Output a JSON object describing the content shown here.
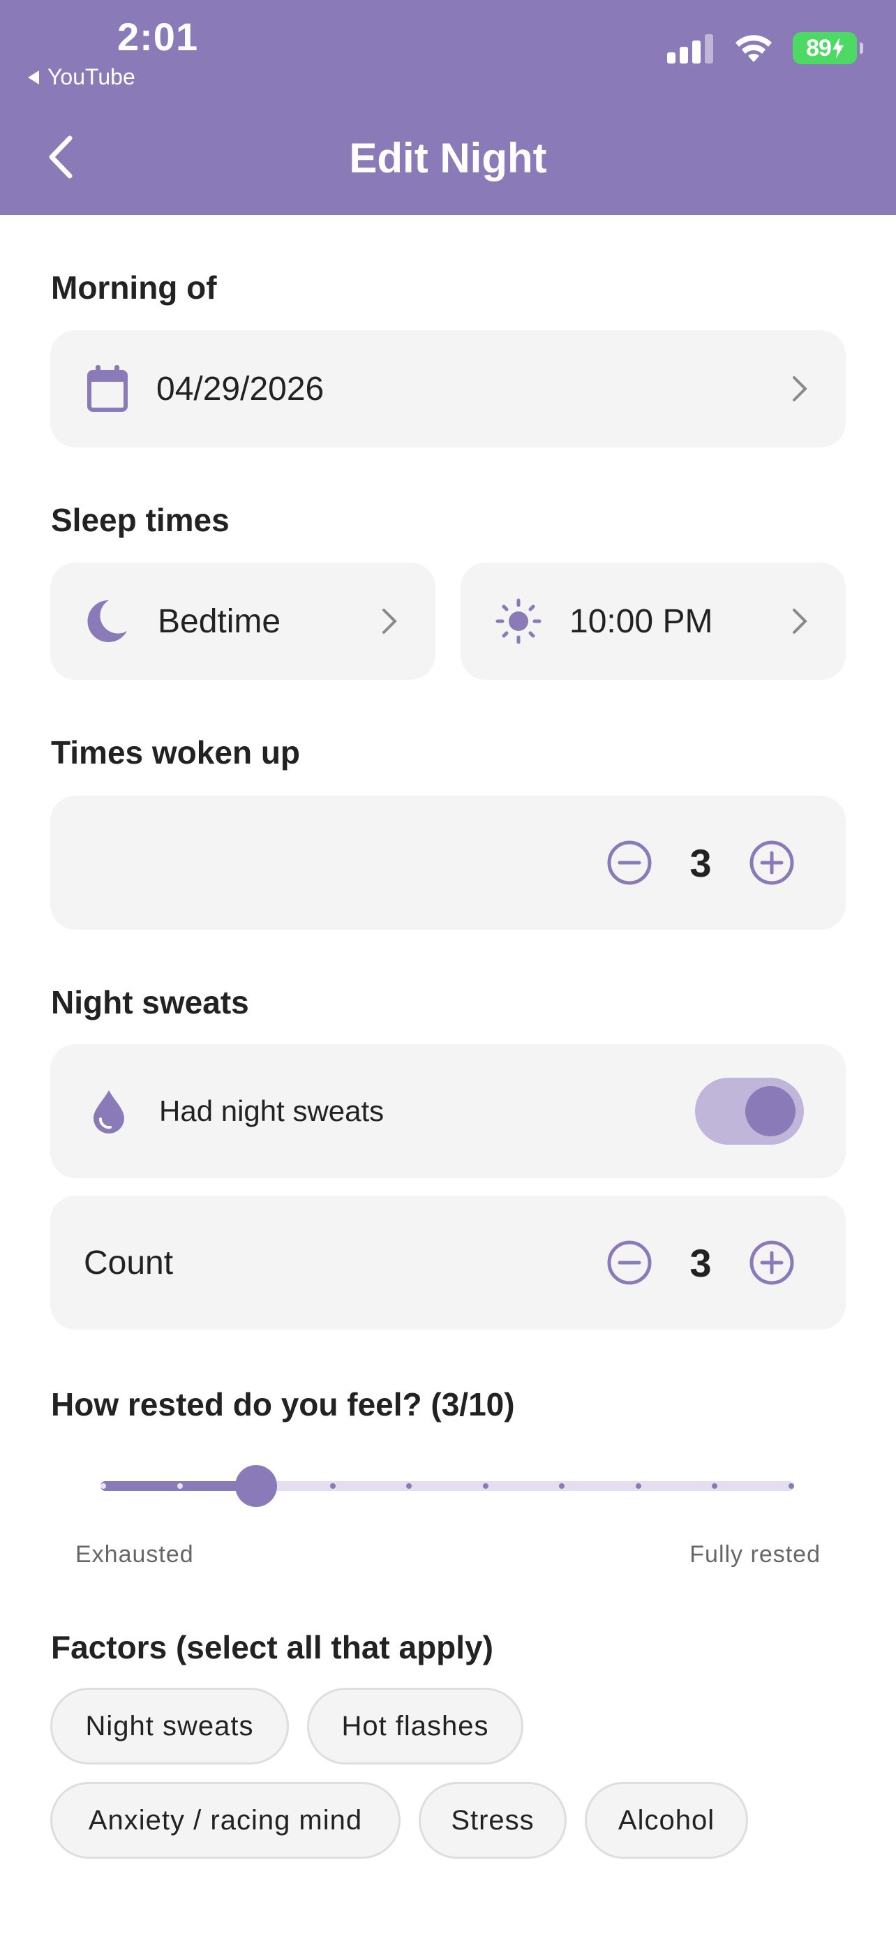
{
  "status_bar": {
    "time": "2:01",
    "back_app": "YouTube",
    "battery": "89"
  },
  "nav": {
    "title": "Edit Night"
  },
  "morning_of": {
    "label": "Morning of",
    "date": "04/29/2026"
  },
  "sleep_times": {
    "label": "Sleep times",
    "bedtime": "Bedtime",
    "wake_time": "10:00 PM"
  },
  "times_woken": {
    "label": "Times woken up",
    "value": "3"
  },
  "night_sweats": {
    "label": "Night sweats",
    "toggle_label": "Had night sweats",
    "toggle_on": true,
    "count_label": "Count",
    "count_value": "3"
  },
  "rested": {
    "label": "How rested do you feel? (3/10)",
    "value": 3,
    "max": 10,
    "min_label": "Exhausted",
    "max_label": "Fully rested"
  },
  "factors": {
    "label": "Factors (select all that apply)",
    "chips": [
      "Night sweats",
      "Hot flashes",
      "Anxiety / racing mind",
      "Stress",
      "Alcohol"
    ]
  },
  "colors": {
    "accent": "#8a7bb8",
    "card": "#f4f4f4",
    "battery": "#4cd964"
  }
}
